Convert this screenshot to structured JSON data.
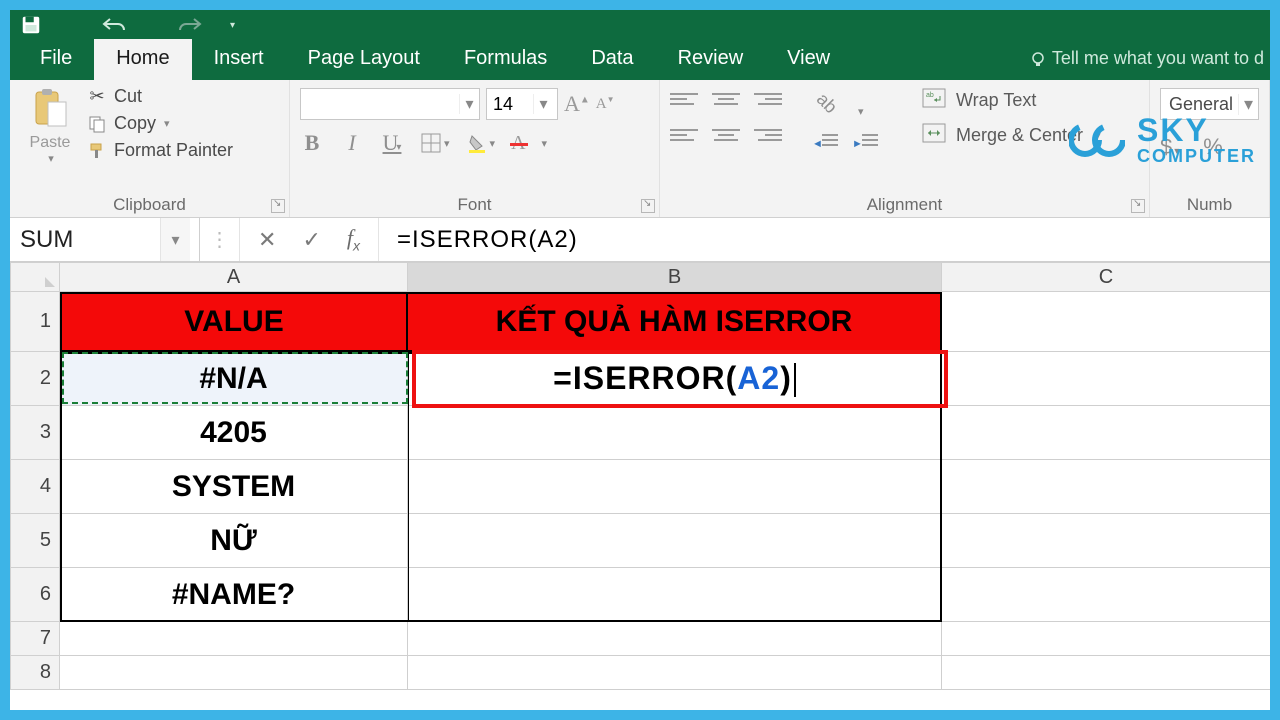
{
  "qat": {
    "save": "save-icon",
    "undo": "undo-icon",
    "redo": "redo-icon"
  },
  "tabs": {
    "file": "File",
    "home": "Home",
    "insert": "Insert",
    "page_layout": "Page Layout",
    "formulas": "Formulas",
    "data": "Data",
    "review": "Review",
    "view": "View",
    "tell_me": "Tell me what you want to d"
  },
  "ribbon": {
    "clipboard": {
      "label": "Clipboard",
      "paste": "Paste",
      "cut": "Cut",
      "copy": "Copy",
      "format_painter": "Format Painter"
    },
    "font": {
      "label": "Font",
      "size": "14"
    },
    "alignment": {
      "label": "Alignment",
      "wrap": "Wrap Text",
      "merge": "Merge & Center"
    },
    "number": {
      "label": "Numb",
      "format": "General"
    }
  },
  "fx": {
    "name_box": "SUM",
    "formula": "=ISERROR(A2)"
  },
  "columns": {
    "A": "A",
    "B": "B",
    "C": "C"
  },
  "rows": {
    "r1": "1",
    "r2": "2",
    "r3": "3",
    "r4": "4",
    "r5": "5",
    "r6": "6",
    "r7": "7",
    "r8": "8"
  },
  "headers": {
    "value": "VALUE",
    "result": "KẾT QUẢ HÀM ISERROR"
  },
  "cells": {
    "A2": "#N/A",
    "A3": "4205",
    "A4": "SYSTEM",
    "A5": "NỮ",
    "A6": "#NAME?",
    "B2_eq": "=",
    "B2_fn": "ISERROR(",
    "B2_ref": "A2",
    "B2_cp": ")"
  },
  "watermark": {
    "line1": "SKY",
    "line2": "COMPUTER"
  }
}
